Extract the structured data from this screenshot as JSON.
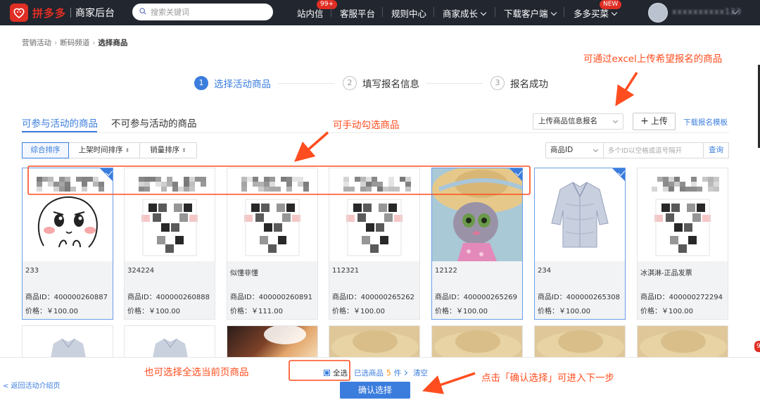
{
  "header": {
    "logo_text": "拼多多",
    "logo_sub": "商家后台",
    "search_placeholder": "搜索关键词",
    "nav": [
      {
        "label": "站内信",
        "badge": "99+"
      },
      {
        "label": "客服平台"
      },
      {
        "label": "规则中心"
      },
      {
        "label": "商家成长"
      },
      {
        "label": "下载客户端"
      },
      {
        "label": "多多买菜",
        "badge": "NEW"
      }
    ]
  },
  "breadcrumb": [
    "营销活动",
    "断码频道",
    "选择商品"
  ],
  "steps": [
    {
      "num": "1",
      "label": "选择活动商品"
    },
    {
      "num": "2",
      "label": "填写报名信息"
    },
    {
      "num": "3",
      "label": "报名成功"
    }
  ],
  "tabs": [
    "可参与活动的商品",
    "不可参与活动的商品"
  ],
  "upload": {
    "select_label": "上传商品信息报名",
    "button_label": "上传",
    "template_link": "下载报名模板"
  },
  "sort": [
    "综合排序",
    "上架时间排序",
    "销量排序"
  ],
  "filter": {
    "field": "商品ID",
    "placeholder": "多个ID以空格或逗号隔开",
    "query": "查询"
  },
  "products": [
    {
      "name": "233",
      "id": "商品ID：400000260887",
      "price": "价格：￥100.00",
      "selected": true,
      "image": "cartoon-face"
    },
    {
      "name": "324224",
      "id": "商品ID：400000260888",
      "price": "价格：￥100.00",
      "selected": false,
      "image": "mosaic"
    },
    {
      "name": "似懂非懂",
      "id": "商品ID：400000260891",
      "price": "价格：￥111.00",
      "selected": false,
      "image": "mosaic"
    },
    {
      "name": "112321",
      "id": "商品ID：400000265262",
      "price": "价格：￥100.00",
      "selected": false,
      "image": "mosaic"
    },
    {
      "name": "12122",
      "id": "商品ID：400000265269",
      "price": "价格：￥100.00",
      "selected": true,
      "image": "bunny"
    },
    {
      "name": "234",
      "id": "商品ID：400000265308",
      "price": "价格：￥100.00",
      "selected": true,
      "image": "shirt"
    },
    {
      "name": "冰淇淋-正品发票",
      "id": "商品ID：400000272294",
      "price": "价格：￥100.00",
      "selected": false,
      "image": "mosaic"
    }
  ],
  "annotations": {
    "excel": "可通过excel上传希望报名的商品",
    "manual": "可手动勾选商品",
    "select_all": "也可选择全选当前页商品",
    "confirm": "点击「确认选择」可进入下一步"
  },
  "footer": {
    "back": "< 返回活动介绍页",
    "select_all": "全选",
    "selected_prefix": "已选商品",
    "selected_count": "5",
    "selected_unit": "件",
    "clear": "清空",
    "confirm": "确认选择"
  },
  "edge_badge": "9",
  "colors": {
    "brand": "#e02e24",
    "primary": "#3b7ddd",
    "annotation": "#ff4d1f",
    "topbar": "#21262f"
  }
}
